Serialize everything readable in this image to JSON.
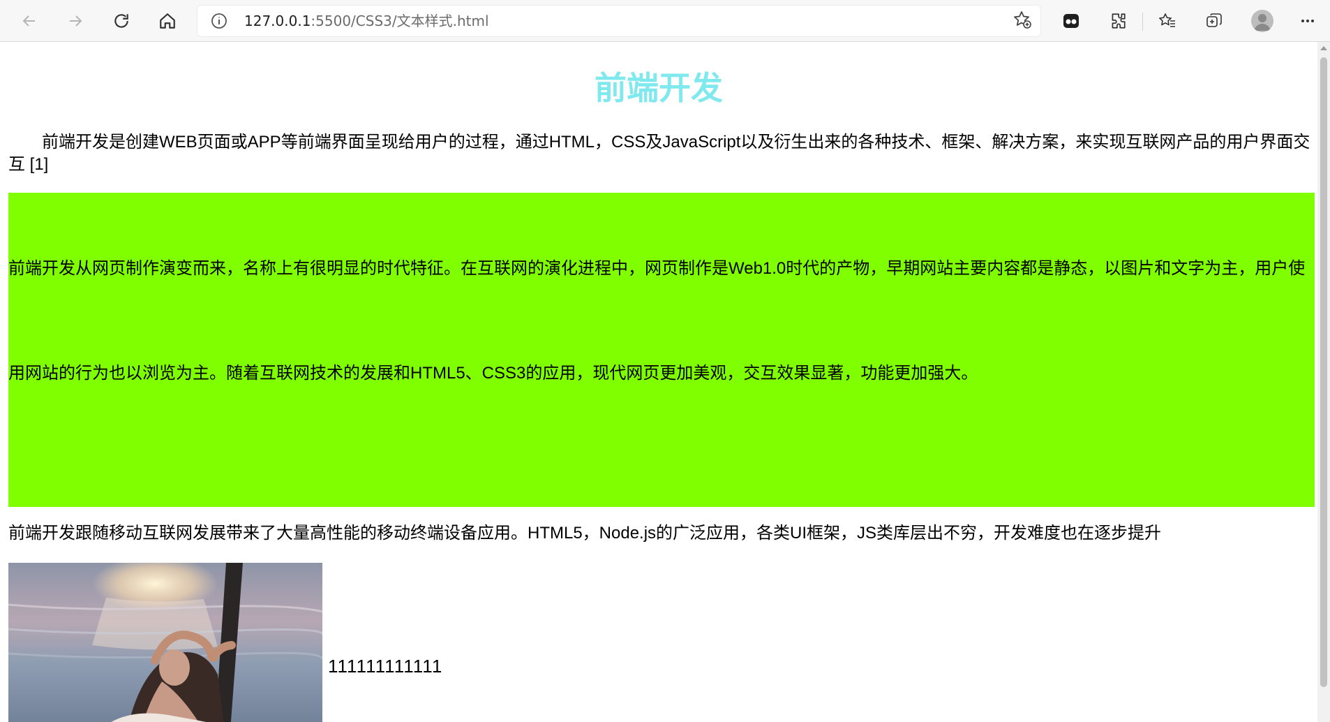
{
  "browser": {
    "url_host": "127.0.0.1",
    "url_rest": ":5500/CSS3/文本样式.html",
    "icons": {
      "back": "back-arrow-icon",
      "forward": "forward-arrow-icon",
      "refresh": "refresh-icon",
      "home": "home-icon",
      "info": "info-icon",
      "add_favorite": "add-favorite-icon",
      "extension_app": "app-icon",
      "extensions": "extensions-puzzle-icon",
      "favorites": "favorites-star-icon",
      "collections": "collections-icon",
      "profile": "profile-avatar",
      "menu": "more-menu-icon"
    }
  },
  "page": {
    "title": "前端开发",
    "title_color": "#7fe9ee",
    "paragraph1": "前端开发是创建WEB页面或APP等前端界面呈现给用户的过程，通过HTML，CSS及JavaScript以及衍生出来的各种技术、框架、解决方案，来实现互联网产品的用户界面交互 [1]",
    "paragraph2": "前端开发从网页制作演变而来，名称上有很明显的时代特征。在互联网的演化进程中，网页制作是Web1.0时代的产物，早期网站主要内容都是静态，以图片和文字为主，用户使用网站的行为也以浏览为主。随着互联网技术的发展和HTML5、CSS3的应用，现代网页更加美观，交互效果显著，功能更加强大。",
    "paragraph2_background": "#7fff00",
    "paragraph3": "前端开发跟随移动互联网发展带来了大量高性能的移动终端设备应用。HTML5，Node.js的广泛应用，各类UI框架，JS类库层出不穷，开发难度也在逐步提升",
    "image_caption": "111111111111"
  }
}
